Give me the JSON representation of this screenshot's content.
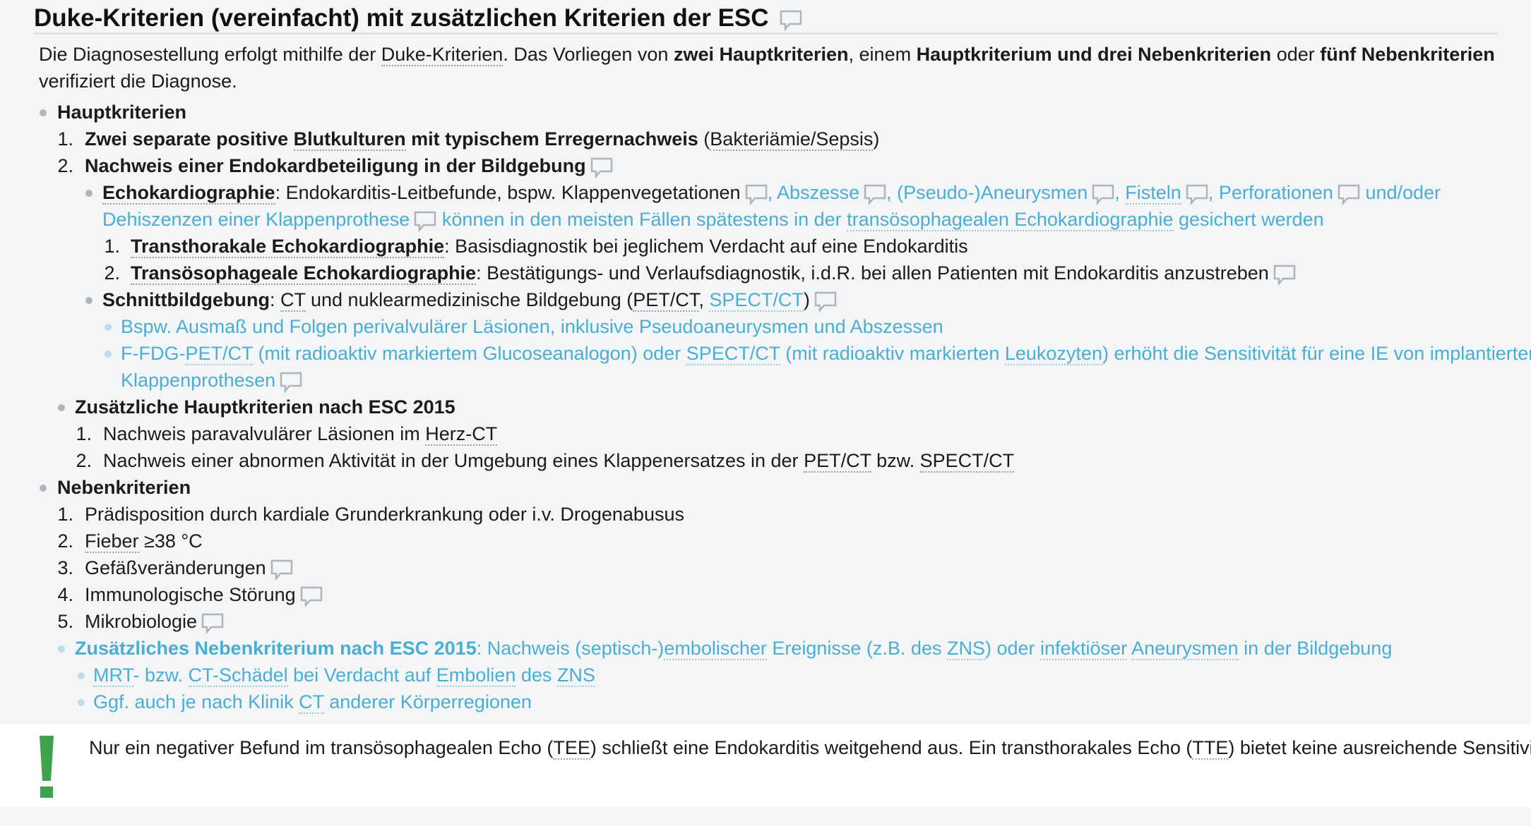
{
  "title": "Duke-Kriterien (vereinfacht) mit zusätzlichen Kriterien der ESC",
  "intro": {
    "p1": "Die Diagnosestellung erfolgt mithilfe der ",
    "link_duke": "Duke-Kriterien",
    "p2": ". Das Vorliegen von ",
    "b1": "zwei Hauptkriterien",
    "p3": ", einem ",
    "b2": "Hauptkriterium und drei Nebenkriterien",
    "p4": " oder ",
    "b3": "fünf Nebenkriterien",
    "p5": "verifiziert die Diagnose."
  },
  "haupt": {
    "label": "Hauptkriterien",
    "i1_b1": "Zwei separate positive ",
    "i1_link": "Blutkulturen",
    "i1_b2": " mit typischem Erregernachweis",
    "i1_p": " (",
    "i1_link2": "Bakteriämie/Sepsis",
    "i1_end": ")",
    "i2": "Nachweis einer Endokardbeteiligung in der Bildgebung",
    "echo_label": "Echokardiographie",
    "echo_text": ": Endokarditis-Leitbefunde, bspw. Klappenvegetationen",
    "abszesse": "Abszesse",
    "pseudo": "(Pseudo-)Aneurysmen",
    "fisteln": "Fisteln",
    "perforationen": "Perforationen",
    "undoder": "und/oder",
    "dehiszenzen": "Dehiszenzen einer Klappenprothese",
    "koennen": "können in den meisten Fällen spätestens in der ",
    "tee_link": "transösophagealen Echokardiographie",
    "gesichert": " gesichert werden",
    "tte_label": "Transthorakale Echokardiographie",
    "tte_text": ": Basisdiagnostik bei jeglichem Verdacht auf eine Endokarditis",
    "tee_label": "Transösophageale Echokardiographie",
    "tee_text": ": Bestätigungs- und Verlaufsdiagnostik, i.d.R. bei allen Patienten mit Endokarditis anzustreben",
    "schnitt_label": "Schnittbildgebung",
    "schnitt_p1": ": ",
    "ct": "CT",
    "schnitt_p2": " und nuklearmedizinische Bildgebung (",
    "petct": "PET/CT",
    "schnitt_p3": ", ",
    "spectct": "SPECT/CT",
    "schnitt_p4": ")",
    "bspw": "Bspw. Ausmaß und Folgen perivalvulärer Läsionen, inklusive Pseudoaneurysmen und Abszessen",
    "ffdg_a": "F-FDG-",
    "ffdg_pet": "PET/CT",
    "ffdg_b": " (mit radioaktiv markiertem Glucoseanalogon) oder ",
    "ffdg_spect": "SPECT/CT",
    "ffdg_c": " (mit radioaktiv markierten ",
    "leuko": "Leukozyten",
    "ffdg_d": ") erhöht die Sensitivität für eine IE von implantierten",
    "klappen": "Klappenprothesen",
    "esc_label": "Zusätzliche Hauptkriterien nach ESC 2015",
    "esc1_a": "Nachweis paravalvulärer Läsionen im ",
    "herzct": "Herz-CT",
    "esc2_a": "Nachweis einer abnormen Aktivität in der Umgebung eines Klappenersatzes in der ",
    "esc2_pet": "PET/CT",
    "esc2_b": " bzw. ",
    "esc2_spect": "SPECT/CT"
  },
  "neben": {
    "label": "Nebenkriterien",
    "n1": "Prädisposition durch kardiale Grunderkrankung oder i.v. Drogenabusus",
    "n2_link": "Fieber",
    "n2_rest": " ≥38 °C",
    "n3": "Gefäßveränderungen",
    "n4": "Immunologische Störung",
    "n5": "Mikrobiologie",
    "esc_label": "Zusätzliches Nebenkriterium nach ESC 2015",
    "esc_a": ": Nachweis (septisch-)",
    "embolischer": "embolischer",
    "esc_b": " Ereignisse (z.B. des ",
    "zns": "ZNS",
    "esc_c": ") oder ",
    "infektioeser": "infektiöser",
    "esc_d": " ",
    "aneurysmen": "Aneurysmen",
    "esc_e": " in der Bildgebung",
    "mrt": "MRT",
    "mrt_b": "- bzw. ",
    "ctschaedel": "CT-Schädel",
    "mrt_c": " bei Verdacht auf ",
    "embolien": "Embolien",
    "mrt_d": " des ",
    "zns2": "ZNS",
    "ggf_a": "Ggf. auch je nach Klinik ",
    "ggf_ct": "CT",
    "ggf_b": " anderer Körperregionen"
  },
  "notice": {
    "a": "Nur ein negativer Befund im transösophagealen Echo (",
    "tee": "TEE",
    "b": ") schließt eine Endokarditis weitgehend aus. Ein transthorakales Echo (",
    "tte": "TTE",
    "c": ") bietet keine ausreichende Sensitivität!"
  },
  "numbers": [
    "1.",
    "2.",
    "3.",
    "4.",
    "5."
  ],
  "colors": {
    "accent_blue": "#4aaed4",
    "exclamation_green": "#3fa34d"
  }
}
